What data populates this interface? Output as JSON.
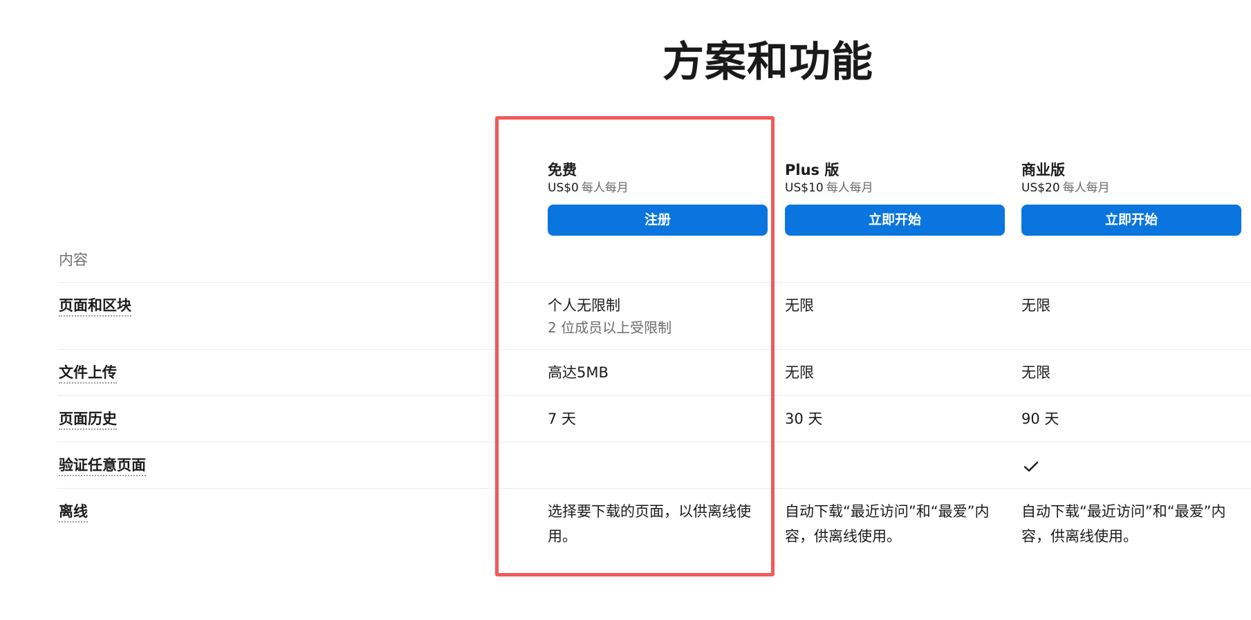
{
  "header": {
    "title": "方案和功能"
  },
  "plans": [
    {
      "name": "免费",
      "price": "US$0",
      "price_unit": "每人每月",
      "button_label": "注册"
    },
    {
      "name": "Plus 版",
      "price": "US$10",
      "price_unit": "每人每月",
      "button_label": "立即开始"
    },
    {
      "name": "商业版",
      "price": "US$20",
      "price_unit": "每人每月",
      "button_label": "立即开始"
    }
  ],
  "section": {
    "label": "内容"
  },
  "rows": [
    {
      "label": "页面和区块",
      "values": [
        {
          "text": "个人无限制",
          "sub": "2 位成员以上受限制"
        },
        {
          "text": "无限"
        },
        {
          "text": "无限"
        }
      ]
    },
    {
      "label": "文件上传",
      "values": [
        {
          "text": "高达5MB"
        },
        {
          "text": "无限"
        },
        {
          "text": "无限"
        }
      ]
    },
    {
      "label": "页面历史",
      "values": [
        {
          "text": "7 天"
        },
        {
          "text": "30 天"
        },
        {
          "text": "90 天"
        }
      ]
    },
    {
      "label": "验证任意页面",
      "values": [
        {
          "text": ""
        },
        {
          "text": ""
        },
        {
          "check": true,
          "icon": "check-icon"
        }
      ]
    },
    {
      "label": "离线",
      "values": [
        {
          "text": "选择要下载的页面，以供离线使用。"
        },
        {
          "text": "自动下载“最近访问”和“最爱”内容，供离线使用。"
        },
        {
          "text": "自动下载“最近访问”和“最爱”内容，供离线使用。"
        }
      ]
    }
  ],
  "colors": {
    "button": "#0a75de",
    "highlight": "#ef5a5a"
  }
}
